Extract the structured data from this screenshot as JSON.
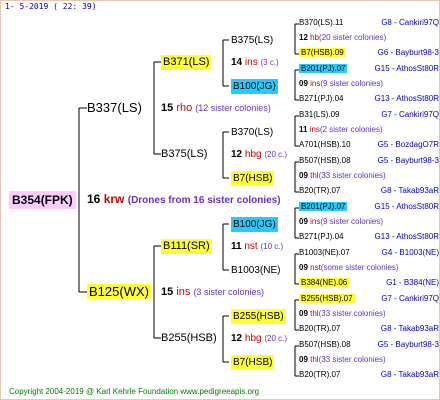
{
  "date": "1-  5-2019 ( 22: 39)",
  "copyright": "Copyright 2004-2019 @ Karl Kehrle Foundation    www.pedigreeapis.org",
  "root": {
    "name": "B354(FPK)",
    "gen_num": "16",
    "gen_code": "krw",
    "gen_note": "(Drones from 16 sister colonies)"
  },
  "g1": [
    {
      "name": "B337(LS)",
      "num": "15",
      "code": "rho",
      "note": "(12 sister colonies)"
    },
    {
      "name": "B125(WX)",
      "num": "15",
      "code": "ins",
      "note": "(3 sister colonies)"
    }
  ],
  "g2": [
    {
      "name": "B371(LS)",
      "num": "14",
      "code": "ins",
      "note": "(3 c.)"
    },
    {
      "name": "B375(LS)",
      "num": "12",
      "code": "hbg",
      "note": "(20 c.)"
    },
    {
      "name": "B111(SR)",
      "num": "11",
      "code": "nst",
      "note": "(10 c.)"
    },
    {
      "name": "B255(HSB)",
      "num": "12",
      "code": "hbg",
      "note": "(20 c.)"
    }
  ],
  "g3": [
    {
      "name": "B375(LS)"
    },
    {
      "name": "B100(JG)"
    },
    {
      "name": "B370(LS)"
    },
    {
      "name": "B7(HSB)"
    },
    {
      "name": "B100(JG)"
    },
    {
      "name": "B1003(NE)"
    },
    {
      "name": "B255(HSB)"
    },
    {
      "name": "B7(HSB)"
    }
  ],
  "leaves": [
    {
      "name": "B370(LS).11",
      "info": "G8 - Cankiri97Q"
    },
    {
      "num": "12",
      "code": "hb",
      "note": "(20 sister colonies)"
    },
    {
      "name": "B7(HSB).09",
      "info": "G6 - Bayburt98-3"
    },
    {
      "name": "B201(PJ).07",
      "info": "G15 - AthosSt80R"
    },
    {
      "num": "09",
      "code": "ins",
      "note": "(9 sister colonies)"
    },
    {
      "name": "B271(PJ).04",
      "info": "G13 - AthosSt80R"
    },
    {
      "name": "B31(LS).09",
      "info": "G7 - Cankiri97Q"
    },
    {
      "num": "11",
      "code": "ins",
      "note": "(2 sister colonies)"
    },
    {
      "name": "A701(HSB).10",
      "info": "G5 - BozdagO7R"
    },
    {
      "name": "B507(HSB).08",
      "info": "G5 - Bayburt98-3"
    },
    {
      "num": "09",
      "code": "thl",
      "note": "(33 sister colonies)"
    },
    {
      "name": "B20(TR).07",
      "info": "G8 - Takab93aR"
    },
    {
      "name": "B201(PJ).07",
      "info": "G15 - AthosSt80R"
    },
    {
      "num": "09",
      "code": "ins",
      "note": "(9 sister colonies)"
    },
    {
      "name": "B271(PJ).04",
      "info": "G13 - AthosSt80R"
    },
    {
      "name": "B1003(NE).07",
      "info": "G4 - B1003(NE)"
    },
    {
      "num": "09",
      "code": "nst",
      "note": "(some sister colonies)"
    },
    {
      "name": "B384(NE).06",
      "info": "G1 - B384(NE)"
    },
    {
      "name": "B255(HSB).07",
      "info": "G7 - Cankiri97Q"
    },
    {
      "num": "09",
      "code": "thl",
      "note": "(33 sister colonies)"
    },
    {
      "name": "B20(TR).07",
      "info": "G8 - Takab93aR"
    },
    {
      "name": "B507(HSB).08",
      "info": "G5 - Bayburt98-3"
    },
    {
      "num": "09",
      "code": "thl",
      "note": "(33 sister colonies)"
    },
    {
      "name": "B20(TR).07",
      "info": "G8 - Takab93aR"
    }
  ]
}
